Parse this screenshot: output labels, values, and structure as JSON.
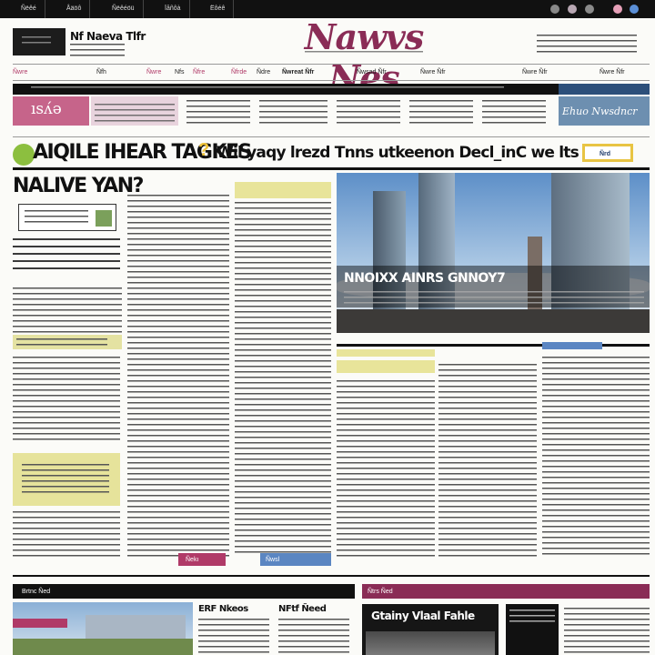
{
  "top_nav": {
    "links": [
      "Ñëêé",
      "Åäöô",
      "Ñëêéöü",
      "Ïåñôà",
      "Ëôéê"
    ]
  },
  "dots": [
    "#888888",
    "#b8a7b3",
    "#8a8a8a",
    "#e6a0b8",
    "#5b8fd6"
  ],
  "masthead": {
    "title": "Nawvs Nes",
    "left_badge": "Nf Naeva Tlfr"
  },
  "nav": {
    "items": [
      "Ñwre",
      "Ñfh",
      "Ñwre",
      "Nfs",
      "Ñfre",
      "Ñfrde",
      "Ñdre",
      "Ñwreat Ñfr",
      "Ñwsad Ñfr",
      "Ñwre Ñfr",
      "Ñwre Ñfr",
      "Ñwre Ñfr"
    ]
  },
  "strip": {
    "pink_box": "ısʌ́ə",
    "side_label": "Ehuo Nwsdncr"
  },
  "headline": {
    "main": "AIQILE IHEAR TAGKES",
    "rest": "Wil yaqy lrezd Tnns utkeenon Decl_inC we lts",
    "tag": "Ñrd"
  },
  "section": {
    "title": "NALIVE YAN?"
  },
  "photo": {
    "caption": "NNOIXX AINRS GNNOY7"
  },
  "buttons": {
    "left": "Ñekı",
    "right": "Ñwsl"
  },
  "bottom": {
    "left_label": "Brtnc Ñed",
    "right_label": "Ñtrs Ñed",
    "card_title_a": "ERF Nkeos",
    "card_title_b": "NFtf Ñeed",
    "card_title_c": "Gtainy Vlaal Fahle"
  }
}
